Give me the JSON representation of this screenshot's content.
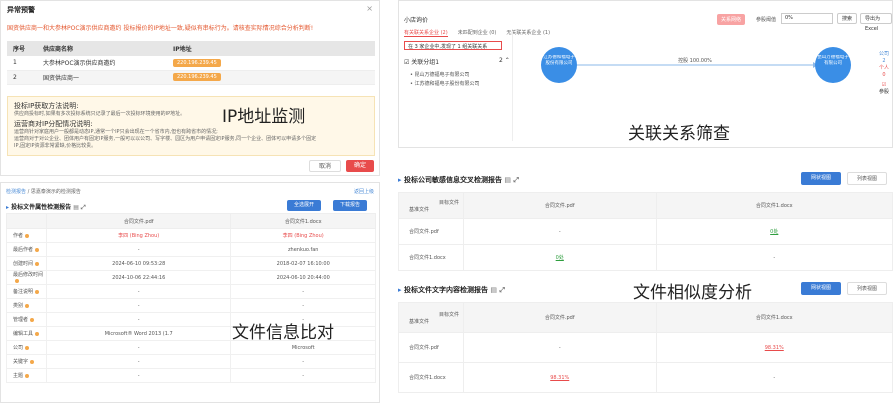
{
  "captions": {
    "ip": "IP地址监测",
    "relation": "关联关系筛查",
    "file_info": "文件信息比对",
    "similarity": "文件相似度分析"
  },
  "ip_dialog": {
    "title": "异常预警",
    "close": "×",
    "warning": "国资供应商一和大参林POC演示供应商邀约 投标报价的IP地址一致,疑似有串标行为。请核查实际情况综合分析判断!",
    "headers": [
      "序号",
      "供应商名称",
      "IP地址"
    ],
    "rows": [
      {
        "no": "1",
        "name": "大参林POC演示供应商邀约",
        "ip": "220.196.239.45"
      },
      {
        "no": "2",
        "name": "国资供应商一",
        "ip": "220.196.239.45"
      }
    ],
    "info_h1": "投标IP获取方法说明:",
    "info_p1": "供应商投标时,如果有多次投标系统只记录了最后一次投标环境使用的IP地址。",
    "info_h2": "运营商对IP分配情况说明:",
    "info_p2": "运营商针对家庭用户一般都是动态IP,通常一个IP只会出现在一个省市内,但也有跨省市的情况;",
    "info_p3": "运营商对于对公企业、团体用户有固定IP服务,一般可以以公司、写字楼、园区为用户申请固定IP服务,同一个企业、团体可以申请多个固定",
    "info_p4": "IP,固定IP资源非常紧缺,价格比较贵。",
    "cancel": "取消",
    "ok": "确定"
  },
  "relation": {
    "title": "小店询价",
    "tag": "关系网络",
    "threshold_label": "参股阈值",
    "threshold_value": "0%",
    "btn_search": "搜索",
    "btn_export": "导出为Excel",
    "tabs": [
      "有关联关系企业 (2)",
      "未匹配到企业 (0)",
      "无关联关系企业 (1)"
    ],
    "found": "在 3 家企业中,发现了 1 组关联关系",
    "group": "关联分组1",
    "group_count": "2",
    "companies": [
      "昆山万德福电子有限公司",
      "江苏德和福电子股份有限公司"
    ],
    "node_left": "江苏德和福电子股份有限公司",
    "node_right": "昆山万德福电子有限公司",
    "edge": "控股 100.00%",
    "side_labels": [
      "公司",
      "2",
      "个人",
      "0"
    ],
    "side_label_last": "参股"
  },
  "file_info": {
    "breadcrumb_link": "检测报告",
    "breadcrumb_rest": "/ 思嘉泰演示的检测报告",
    "link": "返回上级",
    "title": "投标文件属性检测报告",
    "btn_expand": "全选展开",
    "btn_download": "下载报告",
    "headers": [
      "",
      "合同文件.pdf",
      "合同文件1.docx"
    ],
    "rows": [
      {
        "label": "作者",
        "a": "李四 (Bing Zhou)",
        "b": "李四 (Bing Zhou)",
        "red": true
      },
      {
        "label": "最后作者",
        "a": "-",
        "b": "zhenkuo.fan",
        "red": false
      },
      {
        "label": "创建时间",
        "a": "2024-06-10 09:53:28",
        "b": "2018-02-07 16:10:00",
        "red": false
      },
      {
        "label": "最后修改时间",
        "a": "2024-10-06 22:44:16",
        "b": "2024-06-10 20:44:00",
        "red": false
      },
      {
        "label": "备注说明",
        "a": "-",
        "b": "-",
        "red": false
      },
      {
        "label": "类别",
        "a": "-",
        "b": "-",
        "red": false
      },
      {
        "label": "管理者",
        "a": "-",
        "b": "-",
        "red": false
      },
      {
        "label": "编辑工具",
        "a": "Microsoft® Word 2013 (1.7",
        "b": "-",
        "red": false
      },
      {
        "label": "公司",
        "a": "-",
        "b": "Microsoft",
        "red": false
      },
      {
        "label": "关键字",
        "a": "-",
        "b": "-",
        "red": false
      },
      {
        "label": "主题",
        "a": "-",
        "b": "-",
        "red": false
      }
    ]
  },
  "similarity": {
    "tables": [
      {
        "title": "投标公司敏感信息交叉检测报告",
        "btn_active": "网状视图",
        "btn_other": "列表视图",
        "col_header": "目标文件",
        "row_header": "基准文件",
        "cols": [
          "合同文件.pdf",
          "合同文件1.docx"
        ],
        "rows": [
          {
            "label": "合同文件.pdf",
            "cells": [
              "-",
              "0处"
            ]
          },
          {
            "label": "合同文件1.docx",
            "cells": [
              "0处",
              "-"
            ]
          }
        ]
      },
      {
        "title": "投标文件文字内容检测报告",
        "btn_active": "网状视图",
        "btn_other": "列表视图",
        "col_header": "目标文件",
        "row_header": "基准文件",
        "cols": [
          "合同文件.pdf",
          "合同文件1.docx"
        ],
        "rows": [
          {
            "label": "合同文件.pdf",
            "cells": [
              "-",
              "98.31%"
            ]
          },
          {
            "label": "合同文件1.docx",
            "cells": [
              "98.31%",
              "-"
            ]
          }
        ]
      }
    ]
  },
  "colors": {
    "primary_blue": "#3a7bd5",
    "danger_red": "#e84b4b",
    "ip_tag": "#f4a84a",
    "ok_green": "#2e9e3e"
  }
}
